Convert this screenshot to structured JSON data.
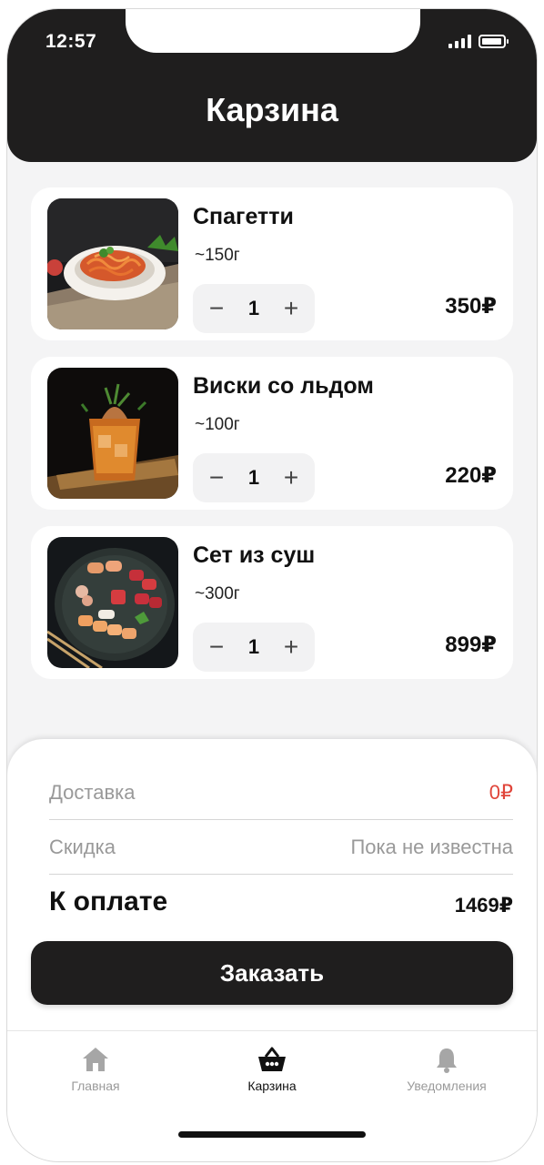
{
  "status_bar": {
    "time": "12:57",
    "signal_icon": "signal-bars-icon",
    "battery_icon": "battery-icon"
  },
  "header": {
    "title": "Карзина"
  },
  "cart": {
    "items": [
      {
        "name": "Спагетти",
        "weight": "~150г",
        "quantity": "1",
        "price": "350₽",
        "minus": "−",
        "plus": "+"
      },
      {
        "name": "Виски со льдом",
        "weight": "~100г",
        "quantity": "1",
        "price": "220₽",
        "minus": "−",
        "plus": "+"
      },
      {
        "name": "Сет из суш",
        "weight": "~300г",
        "quantity": "1",
        "price": "899₽",
        "minus": "−",
        "plus": "+"
      }
    ]
  },
  "summary": {
    "delivery_label": "Доставка",
    "delivery_value": "0₽",
    "discount_label": "Скидка",
    "discount_value": "Пока не известна",
    "total_label": "К оплате",
    "total_value": "1469₽",
    "order_button": "Заказать"
  },
  "tabbar": {
    "tabs": [
      {
        "label": "Главная",
        "icon": "home-icon",
        "active": false
      },
      {
        "label": "Карзина",
        "icon": "basket-icon",
        "active": true
      },
      {
        "label": "Уведомления",
        "icon": "bell-icon",
        "active": false
      }
    ]
  },
  "colors": {
    "dark": "#1f1e1e",
    "accent_red": "#e0453a",
    "background": "#f4f4f5"
  }
}
